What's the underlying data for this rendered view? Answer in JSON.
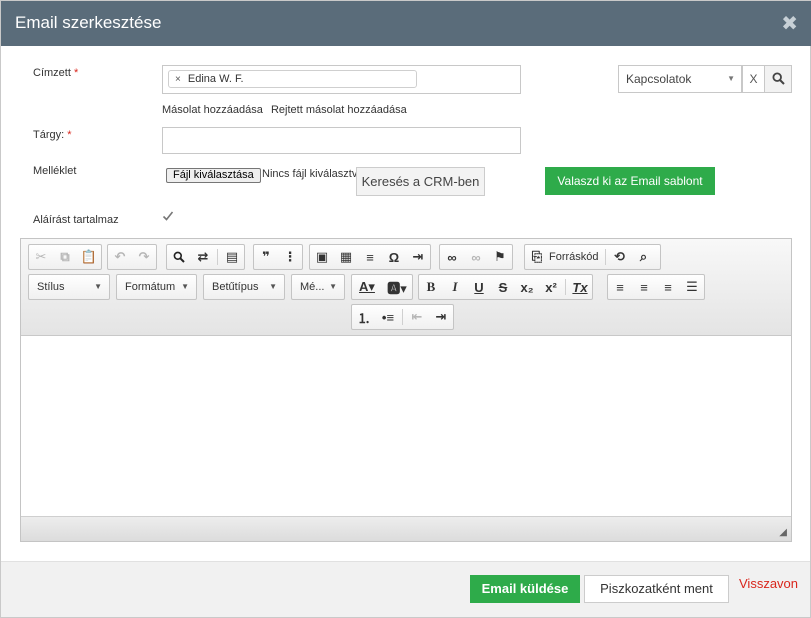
{
  "dialog": {
    "title": "Email szerkesztése"
  },
  "form": {
    "to_label": "Címzett",
    "required_mark": "*",
    "recipient_tag": "Edina W. F.",
    "recipient_remove": "×",
    "contacts_select": "Kapcsolatok",
    "clear_button": "X",
    "cc_link": "Másolat hozzáadása",
    "bcc_link": "Rejtett másolat hozzáadása",
    "subject_label": "Tárgy:",
    "subject_value": "",
    "attachment_label": "Melléklet",
    "choose_file_button": "Fájl kiválasztása",
    "no_file_text": "Nincs fájl kiválasztva",
    "crm_search_button": "Keresés a CRM-ben",
    "template_button": "Valaszd ki az Email sablont",
    "signature_label": "Aláírást tartalmaz",
    "signature_checked": true
  },
  "editor": {
    "combos": {
      "style": "Stílus",
      "format": "Formátum",
      "font": "Betűtípus",
      "size": "Mé..."
    },
    "source_label": "Forráskód",
    "content": ""
  },
  "footer": {
    "send_button": "Email küldése",
    "draft_button": "Piszkozatként ment",
    "cancel_link": "Visszavon"
  }
}
